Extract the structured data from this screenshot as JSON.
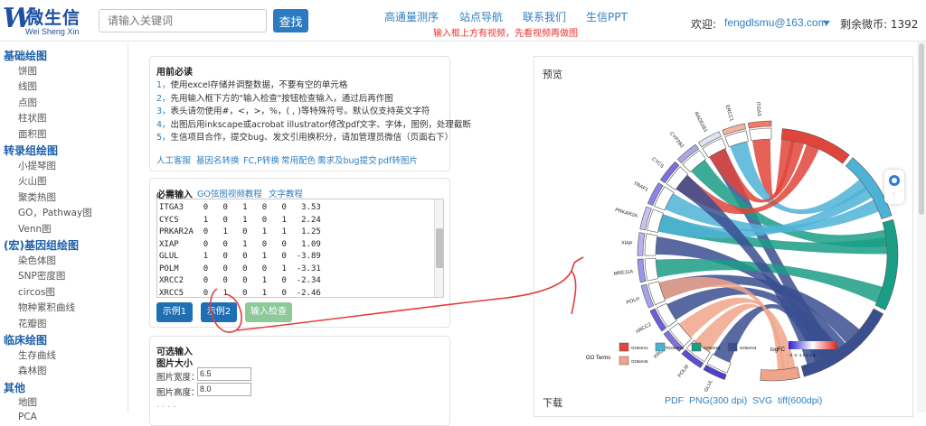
{
  "header": {
    "logo_cn": "微生信",
    "logo_w": "W",
    "logo_en": "Wei Sheng Xin",
    "search_placeholder": "请输入关键词",
    "search_button": "查找",
    "nav": [
      "高通量测序",
      "站点导航",
      "联系我们",
      "生信PPT"
    ],
    "notice": "输入框上方有视频，先看视频再做图",
    "welcome": "欢迎:",
    "email": "fengdlsmu@163.com",
    "coins": "剩余微币: 1392"
  },
  "sidebar": [
    {
      "type": "h",
      "label": "基础绘图"
    },
    {
      "type": "i",
      "label": "饼图"
    },
    {
      "type": "i",
      "label": "线图"
    },
    {
      "type": "i",
      "label": "点图"
    },
    {
      "type": "i",
      "label": "柱状图"
    },
    {
      "type": "i",
      "label": "面积图"
    },
    {
      "type": "h",
      "label": "转录组绘图"
    },
    {
      "type": "i",
      "label": "小提琴图"
    },
    {
      "type": "i",
      "label": "火山图"
    },
    {
      "type": "i",
      "label": "聚类热图"
    },
    {
      "type": "i",
      "label": "GO，Pathway图"
    },
    {
      "type": "i",
      "label": "Venn图"
    },
    {
      "type": "h",
      "label": "(宏)基因组绘图"
    },
    {
      "type": "i",
      "label": "染色体图"
    },
    {
      "type": "i",
      "label": "SNP密度图"
    },
    {
      "type": "i",
      "label": "circos图"
    },
    {
      "type": "i",
      "label": "物种累积曲线"
    },
    {
      "type": "i",
      "label": "花瓣图"
    },
    {
      "type": "h",
      "label": "临床绘图"
    },
    {
      "type": "i",
      "label": "生存曲线"
    },
    {
      "type": "i",
      "label": "森林图"
    },
    {
      "type": "h",
      "label": "其他"
    },
    {
      "type": "i",
      "label": "地图"
    },
    {
      "type": "i",
      "label": "PCA"
    }
  ],
  "instructions": {
    "title": "用前必读",
    "lines": [
      {
        "num": "1，",
        "text": "使用excel存储并调整数据，不要有空的单元格"
      },
      {
        "num": "2，",
        "text": "先用输入框下方的\"输入检查\"按钮检查输入，通过后再作图"
      },
      {
        "num": "3，",
        "text": "表头请勿使用#，<，>，%，( , )等特殊符号。默认仅支持英文字符"
      },
      {
        "num": "4，",
        "text": "出图后用inkscape或acrobat illustrator修改pdf文字、字体，图例，处理截断"
      },
      {
        "num": "5，",
        "text": "生信项目合作，提交bug、发文引用换积分，请加管理员微信（页面右下）"
      }
    ],
    "links": [
      "人工客服",
      "基因名转换",
      "FC,P转换",
      "常用配色",
      "需求及bug提交",
      "pdf转图片"
    ]
  },
  "required_input": {
    "title": "必需输入",
    "links": [
      "GO弦图视频教程",
      "文字教程"
    ],
    "rows": [
      "ITGA3    0   0   1   0   0   3.53",
      "CYCS     1   0   1   0   1   2.24",
      "PRKAR2A  0   1   0   1   1   1.25",
      "XIAP     0   0   1   0   0   1.09",
      "GLUL     1   0   0   1   0  -3.89",
      "POLM     0   0   0   0   1  -3.31",
      "XRCC2    0   0   0   1   0  -2.34",
      "XRCC5    0   1   0   1   0  -2.46"
    ],
    "buttons": [
      "示例1",
      "示例2",
      "输入检查"
    ]
  },
  "optional_input": {
    "title": "可选输入",
    "subtitle": "图片大小",
    "width_label": "图片宽度：",
    "width_value": "6.5",
    "height_label": "图片高度：",
    "height_value": "8.0"
  },
  "preview": {
    "title": "预览",
    "gene_labels": [
      "ITGA3",
      "ERCC1",
      "RAD51B1",
      "CYP2B2",
      "CYCS",
      "TRAF1",
      "PRKAR2A",
      "XIAP",
      "MRE11A",
      "POLH",
      "XRCC2",
      "XRCC5",
      "POLM",
      "GLUL"
    ],
    "legend_title": "GO Terms",
    "go_terms": [
      "GOterm1",
      "GOterm2",
      "GOterm3",
      "GOterm4",
      "GOterm5"
    ],
    "go_colors": [
      "#e0453a",
      "#4db3d6",
      "#1a9e86",
      "#3a4f8f",
      "#f0a48a"
    ],
    "logfc_label": "logFC",
    "logfc_ticks": "-3 -2 -1 0 1 2 3"
  },
  "download": {
    "title": "下载",
    "links": [
      "PDF",
      "PNG(300 dpi)",
      "SVG",
      "tiff(600dpi)"
    ]
  }
}
